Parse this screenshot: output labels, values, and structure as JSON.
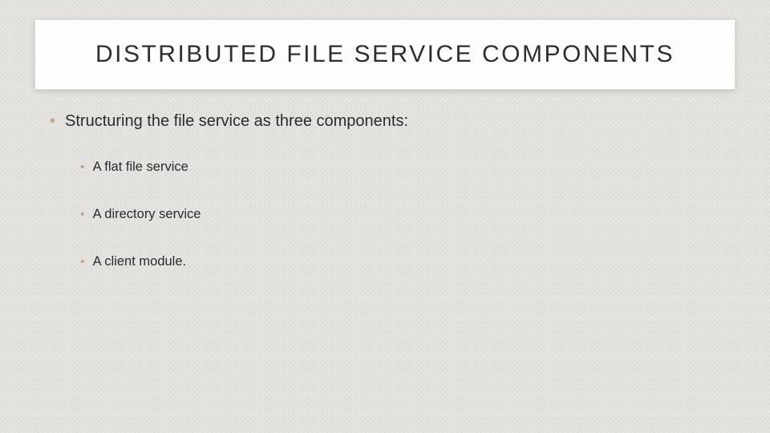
{
  "title": "DISTRIBUTED FILE SERVICE COMPONENTS",
  "main_bullet": "Structuring the file service as three components:",
  "sub_bullets": [
    "A flat file service",
    "A directory service",
    "A client module."
  ]
}
